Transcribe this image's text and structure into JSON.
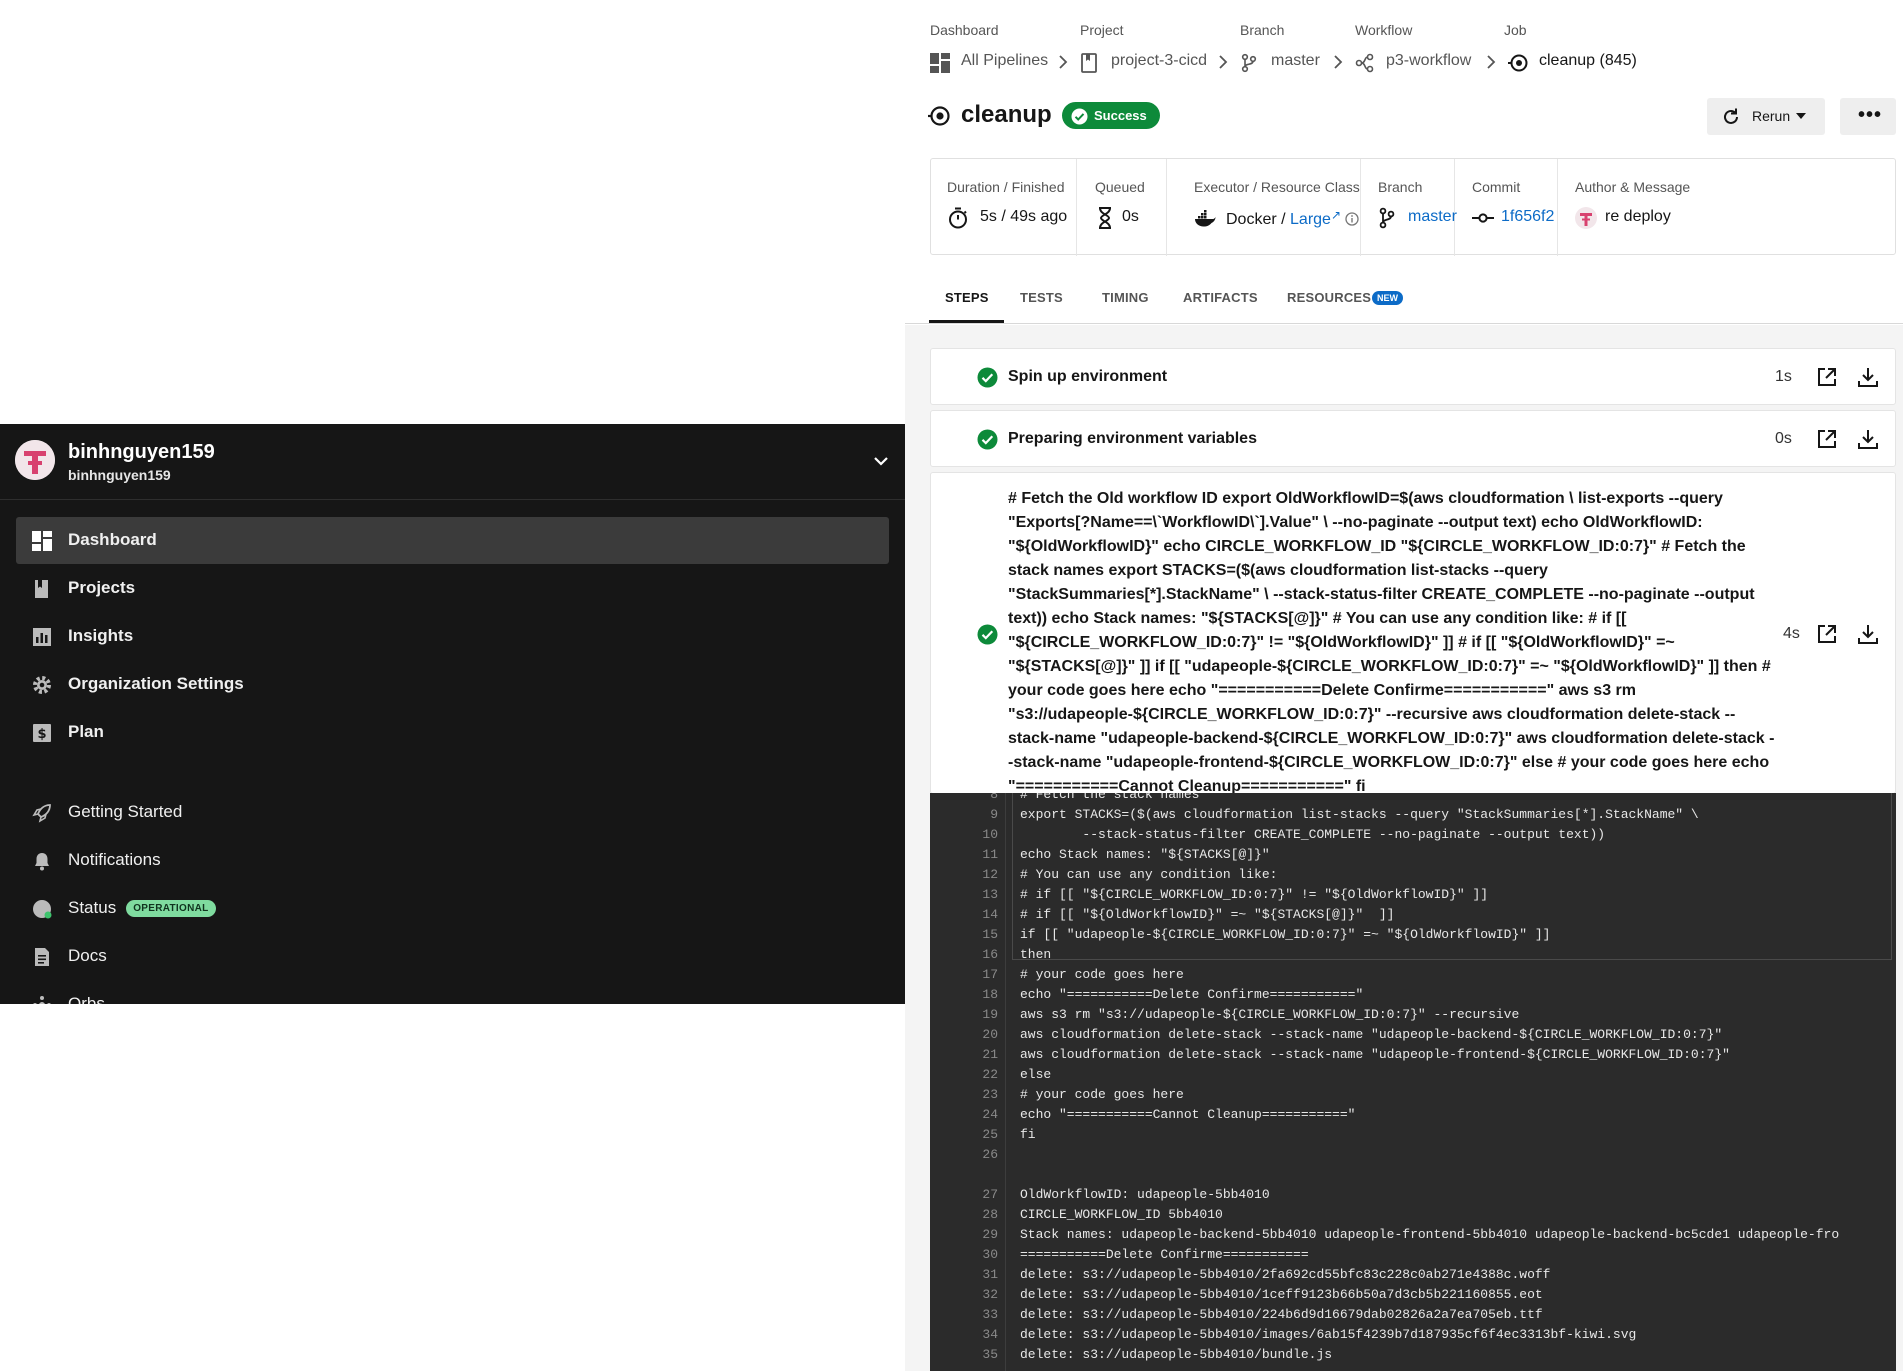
{
  "colors": {
    "sidebar_bg": "#161616",
    "success": "#0d8a3a",
    "link": "#0c6bc7",
    "console_bg": "#2b2b2b",
    "operational": "#7fdb9f"
  },
  "user": {
    "name": "binhnguyen159",
    "handle": "binhnguyen159"
  },
  "nav": {
    "primary": [
      {
        "label": "Dashboard",
        "icon": "dashboard-icon",
        "active": true
      },
      {
        "label": "Projects",
        "icon": "book-icon"
      },
      {
        "label": "Insights",
        "icon": "bar-chart-icon"
      },
      {
        "label": "Organization Settings",
        "icon": "gear-icon"
      },
      {
        "label": "Plan",
        "icon": "dollar-icon"
      }
    ],
    "secondary": [
      {
        "label": "Getting Started",
        "icon": "rocket-icon"
      },
      {
        "label": "Notifications",
        "icon": "bell-icon"
      },
      {
        "label": "Status",
        "icon": "status-icon",
        "badge": "OPERATIONAL"
      },
      {
        "label": "Docs",
        "icon": "doc-icon"
      },
      {
        "label": "Orbs",
        "icon": "orbs-icon"
      }
    ]
  },
  "breadcrumb": [
    {
      "label": "Dashboard",
      "value": "All Pipelines",
      "icon": "pipelines-icon"
    },
    {
      "label": "Project",
      "value": "project-3-cicd",
      "icon": "project-icon"
    },
    {
      "label": "Branch",
      "value": "master",
      "icon": "branch-icon"
    },
    {
      "label": "Workflow",
      "value": "p3-workflow",
      "icon": "workflow-icon"
    },
    {
      "label": "Job",
      "value": "cleanup (845)",
      "icon": "job-icon"
    }
  ],
  "job": {
    "title": "cleanup",
    "status": "Success",
    "rerun_label": "Rerun",
    "more_label": "•••"
  },
  "meta": {
    "duration": {
      "label": "Duration / Finished",
      "value": "5s / 49s ago"
    },
    "queued": {
      "label": "Queued",
      "value": "0s"
    },
    "executor": {
      "label": "Executor / Resource Class",
      "value": "Docker /",
      "class": "Large"
    },
    "branch": {
      "label": "Branch",
      "value": "master"
    },
    "commit": {
      "label": "Commit",
      "value": "1f656f2"
    },
    "author": {
      "label": "Author & Message",
      "value": "re deploy"
    }
  },
  "tabs": [
    {
      "label": "STEPS",
      "active": true
    },
    {
      "label": "TESTS"
    },
    {
      "label": "TIMING"
    },
    {
      "label": "ARTIFACTS"
    },
    {
      "label": "RESOURCES",
      "badge": "NEW"
    }
  ],
  "steps": [
    {
      "name": "Spin up environment",
      "duration": "1s",
      "expanded": false
    },
    {
      "name": "Preparing environment variables",
      "duration": "0s",
      "expanded": false
    },
    {
      "name": "# Fetch the Old workflow ID export OldWorkflowID=$(aws cloudformation \\ list-exports --query \"Exports[?Name==\\`WorkflowID\\`].Value\" \\ --no-paginate --output text) echo OldWorkflowID: \"${OldWorkflowID}\" echo CIRCLE_WORKFLOW_ID \"${CIRCLE_WORKFLOW_ID:0:7}\" # Fetch the stack names export STACKS=($(aws cloudformation list-stacks --query \"StackSummaries[*].StackName\" \\ --stack-status-filter CREATE_COMPLETE --no-paginate --output text)) echo Stack names: \"${STACKS[@]}\" # You can use any condition like: # if [[ \"${CIRCLE_WORKFLOW_ID:0:7}\" != \"${OldWorkflowID}\" ]] # if [[ \"${OldWorkflowID}\" =~ \"${STACKS[@]}\" ]] if [[ \"udapeople-${CIRCLE_WORKFLOW_ID:0:7}\" =~ \"${OldWorkflowID}\" ]] then # your code goes here echo \"===========Delete Confirme===========\" aws s3 rm \"s3://udapeople-${CIRCLE_WORKFLOW_ID:0:7}\" --recursive aws cloudformation delete-stack --stack-name \"udapeople-backend-${CIRCLE_WORKFLOW_ID:0:7}\" aws cloudformation delete-stack --stack-name \"udapeople-frontend-${CIRCLE_WORKFLOW_ID:0:7}\" else # your code goes here echo \"===========Cannot Cleanup===========\" fi",
      "duration": "4s",
      "expanded": true
    }
  ],
  "console": {
    "script_lines": [
      {
        "n": "8",
        "text": "# Fetch the stack names"
      },
      {
        "n": "9",
        "text": "export STACKS=($(aws cloudformation list-stacks --query \"StackSummaries[*].StackName\" \\"
      },
      {
        "n": "10",
        "text": "        --stack-status-filter CREATE_COMPLETE --no-paginate --output text))"
      },
      {
        "n": "11",
        "text": "echo Stack names: \"${STACKS[@]}\""
      },
      {
        "n": "12",
        "text": "# You can use any condition like:"
      },
      {
        "n": "13",
        "text": "# if [[ \"${CIRCLE_WORKFLOW_ID:0:7}\" != \"${OldWorkflowID}\" ]]"
      },
      {
        "n": "14",
        "text": "# if [[ \"${OldWorkflowID}\" =~ \"${STACKS[@]}\"  ]]"
      },
      {
        "n": "15",
        "text": "if [[ \"udapeople-${CIRCLE_WORKFLOW_ID:0:7}\" =~ \"${OldWorkflowID}\" ]]"
      },
      {
        "n": "16",
        "text": "then"
      },
      {
        "n": "17",
        "text": "# your code goes here"
      },
      {
        "n": "18",
        "text": "echo \"===========Delete Confirme===========\""
      },
      {
        "n": "19",
        "text": "aws s3 rm \"s3://udapeople-${CIRCLE_WORKFLOW_ID:0:7}\" --recursive"
      },
      {
        "n": "20",
        "text": "aws cloudformation delete-stack --stack-name \"udapeople-backend-${CIRCLE_WORKFLOW_ID:0:7}\""
      },
      {
        "n": "21",
        "text": "aws cloudformation delete-stack --stack-name \"udapeople-frontend-${CIRCLE_WORKFLOW_ID:0:7}\""
      },
      {
        "n": "22",
        "text": "else"
      },
      {
        "n": "23",
        "text": "# your code goes here"
      },
      {
        "n": "24",
        "text": "echo \"===========Cannot Cleanup===========\""
      },
      {
        "n": "25",
        "text": "fi"
      },
      {
        "n": "26",
        "text": ""
      }
    ],
    "output_lines": [
      {
        "n": "27",
        "text": "OldWorkflowID: udapeople-5bb4010"
      },
      {
        "n": "28",
        "text": "CIRCLE_WORKFLOW_ID 5bb4010"
      },
      {
        "n": "29",
        "text": "Stack names: udapeople-backend-5bb4010 udapeople-frontend-5bb4010 udapeople-backend-bc5cde1 udapeople-fro"
      },
      {
        "n": "30",
        "text": "===========Delete Confirme==========="
      },
      {
        "n": "31",
        "text": "delete: s3://udapeople-5bb4010/2fa692cd55bfc83c228c0ab271e4388c.woff"
      },
      {
        "n": "32",
        "text": "delete: s3://udapeople-5bb4010/1ceff9123b66b50a7d3cb5b221160855.eot"
      },
      {
        "n": "33",
        "text": "delete: s3://udapeople-5bb4010/224b6d9d16679dab02826a2a7ea705eb.ttf"
      },
      {
        "n": "34",
        "text": "delete: s3://udapeople-5bb4010/images/6ab15f4239b7d187935cf6f4ec3313bf-kiwi.svg"
      },
      {
        "n": "35",
        "text": "delete: s3://udapeople-5bb4010/bundle.js"
      }
    ]
  }
}
